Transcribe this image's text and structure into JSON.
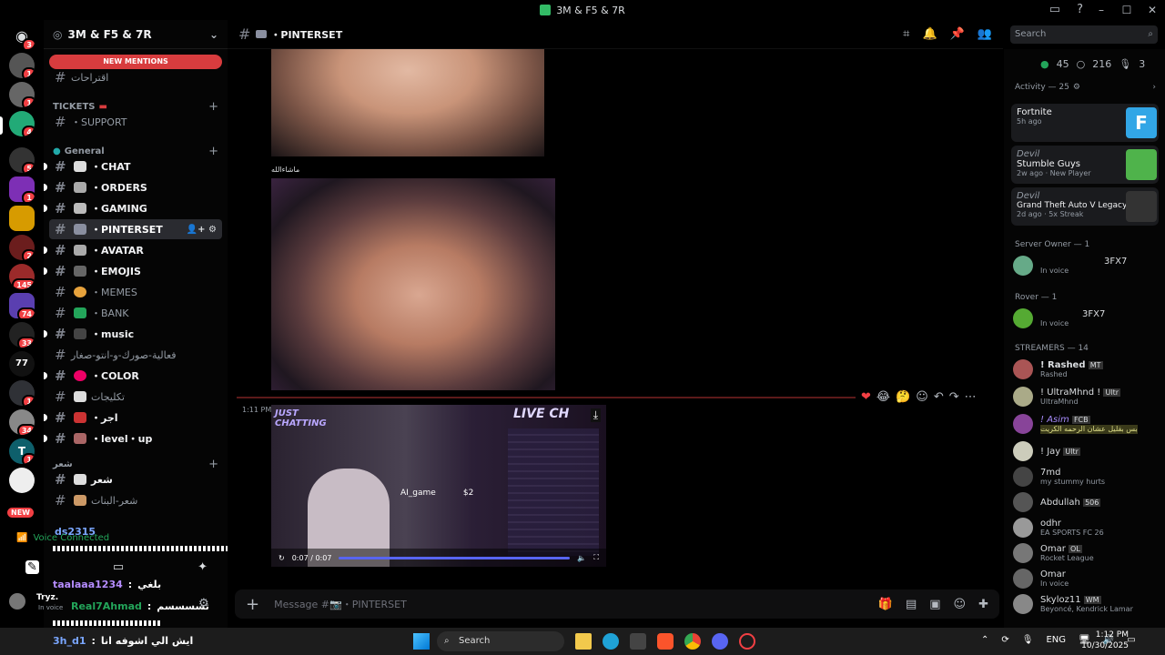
{
  "window": {
    "title": "3M & F5 & 7R"
  },
  "server": {
    "name": "3M & F5 & 7R",
    "new_mentions": "NEW MENTIONS"
  },
  "server_badges": [
    "3",
    "1",
    "1",
    "4",
    "5",
    "1",
    "2",
    "145",
    "74",
    "33",
    "1",
    "34",
    "1",
    "NEW"
  ],
  "categories": {
    "tickets": "TICKETS",
    "general": "General",
    "poetry": "شعر"
  },
  "channels": {
    "top": "اقتراحات",
    "support": "SUPPORT",
    "chat": "CHAT",
    "orders": "ORDERS",
    "gaming": "GAMING",
    "pinterset": "PINTERSET",
    "avatar": "AVATAR",
    "emojis": "EMOJIS",
    "memes": "MEMES",
    "bank": "BANK",
    "music": "music",
    "ar1": "فعالية-صورك-و-انتو-صغار",
    "color": "COLOR",
    "ar2": "تكليجات",
    "ar3": "اجر",
    "level": "level・up",
    "ar4": "شعر",
    "ar5": "شعر-البنات"
  },
  "voice": {
    "status": "Voice Connected",
    "channel": "ds2315",
    "user1": "taalaaa1234",
    "user1_msg": "بلغي",
    "user2": "Real7Ahmad",
    "user2_msg": "تسسسسم",
    "self": "Tryz.",
    "self_status": "In voice",
    "bottom_user": "3h_d1",
    "bottom_msg": "ايش الي اشوفه انا"
  },
  "chat": {
    "channel": "PINTERSET",
    "timestamp": "1:11 PM",
    "caption": "ماشاءالله",
    "composer_placeholder": "Message #📷・PINTERSET",
    "video_time": "0:07 / 0:07",
    "video_label_left": "JUST CHATTING",
    "video_label_right": "LIVE CH",
    "video_name": "AI_game",
    "video_amount": "$2"
  },
  "search": {
    "placeholder": "Search"
  },
  "members": {
    "online": "45",
    "total": "216",
    "voice": "3",
    "activity_label": "Activity — 25",
    "activities": [
      {
        "game": "Fortnite",
        "sub": "5h ago",
        "user": ""
      },
      {
        "game": "Stumble Guys",
        "sub": "2w ago · New Player",
        "user": "Devil"
      },
      {
        "game": "Grand Theft Auto V Legacy",
        "sub": "2d ago · 5x Streak",
        "user": "Devil"
      }
    ],
    "group_owner": "Server Owner — 1",
    "owner": {
      "name": "3FX7",
      "status": "In voice"
    },
    "group_rover": "Rover — 1",
    "rover": {
      "name": "3FX7",
      "status": "In voice"
    },
    "group_streamers": "STREAMERS — 14",
    "list": [
      {
        "name": "! Rashed",
        "tag": "MT",
        "status": "Rashed"
      },
      {
        "name": "! UltraMhnd !",
        "tag": "Ultr",
        "status": "UltraMhnd"
      },
      {
        "name": "! Asim",
        "tag": "FCB",
        "status": "بس بقليل عشان الرحمه الكريت"
      },
      {
        "name": "! Jay",
        "tag": "Ultr",
        "status": ""
      },
      {
        "name": "7md",
        "tag": "",
        "status": "my stummy hurts"
      },
      {
        "name": "Abdullah",
        "tag": "506",
        "status": ""
      },
      {
        "name": "odhr",
        "tag": "",
        "status": "EA SPORTS FC 26"
      },
      {
        "name": "Omar",
        "tag": "OL",
        "status": "Rocket League"
      },
      {
        "name": "Omar",
        "tag": "",
        "status": "In voice"
      },
      {
        "name": "Skyloz11",
        "tag": "WM",
        "status": "Beyoncé, Kendrick Lamar"
      }
    ]
  },
  "taskbar": {
    "search": "Search",
    "lang": "ENG",
    "time": "1:12 PM",
    "date": "10/30/2025"
  },
  "colors": {
    "accent": "#5865f2",
    "danger": "#f23f43",
    "online": "#23a55a"
  }
}
